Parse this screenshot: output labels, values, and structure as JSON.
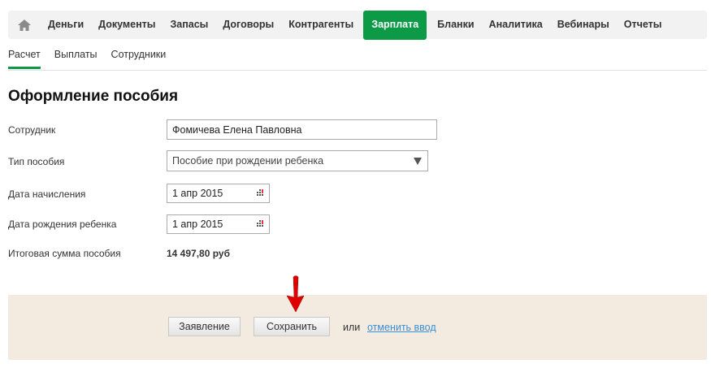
{
  "nav": {
    "items": [
      {
        "label": "Деньги"
      },
      {
        "label": "Документы"
      },
      {
        "label": "Запасы"
      },
      {
        "label": "Договоры"
      },
      {
        "label": "Контрагенты"
      },
      {
        "label": "Зарплата",
        "active": true
      },
      {
        "label": "Бланки"
      },
      {
        "label": "Аналитика"
      },
      {
        "label": "Вебинары"
      },
      {
        "label": "Отчеты"
      }
    ]
  },
  "subtabs": [
    {
      "label": "Расчет",
      "active": true
    },
    {
      "label": "Выплаты"
    },
    {
      "label": "Сотрудники"
    }
  ],
  "page_title": "Оформление пособия",
  "form": {
    "employee_label": "Сотрудник",
    "employee_value": "Фомичева Елена Павловна",
    "type_label": "Тип пособия",
    "type_value": "Пособие при рождении ребенка",
    "accrual_date_label": "Дата начисления",
    "accrual_date_value": "1 апр 2015",
    "birth_date_label": "Дата рождения ребенка",
    "birth_date_value": "1 апр 2015",
    "total_label": "Итоговая сумма пособия",
    "total_value": "14 497,80 руб"
  },
  "footer": {
    "statement_label": "Заявление",
    "save_label": "Сохранить",
    "or_text": "или",
    "cancel_link": "отменить ввод"
  },
  "colors": {
    "accent": "#0c9a47",
    "footer_bg": "#f3ebe0",
    "link": "#3a8fd6",
    "arrow": "#e00000"
  }
}
